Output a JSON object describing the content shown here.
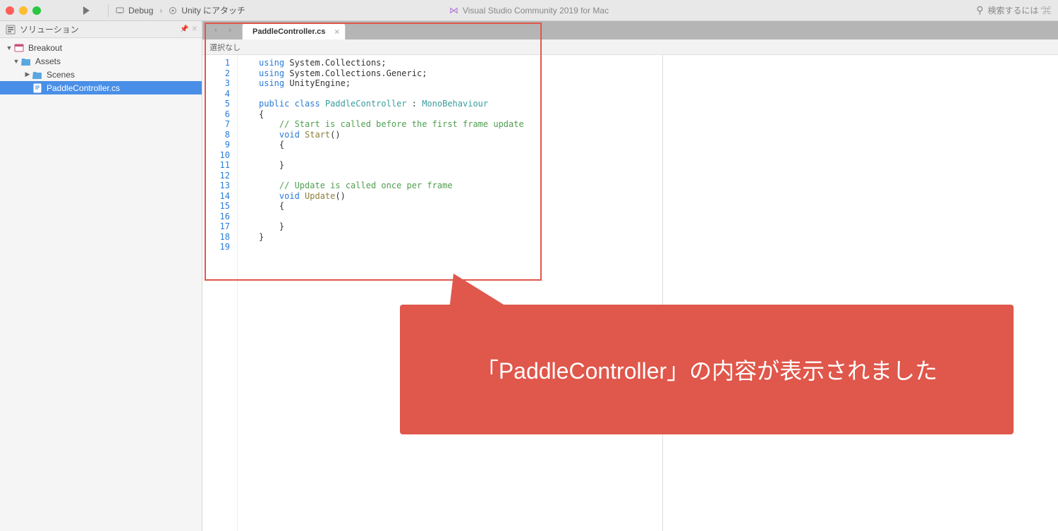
{
  "toolbar": {
    "config_name": "Debug",
    "attach_label": "Unity にアタッチ",
    "app_title": "Visual Studio Community 2019 for Mac",
    "search_hint": "検索するには '⌘"
  },
  "sidebar": {
    "panel_title": "ソリューション",
    "items": [
      {
        "label": "Breakout",
        "depth": 0,
        "type": "project",
        "expanded": true
      },
      {
        "label": "Assets",
        "depth": 1,
        "type": "folder",
        "expanded": true
      },
      {
        "label": "Scenes",
        "depth": 2,
        "type": "folder",
        "expanded": false
      },
      {
        "label": "PaddleController.cs",
        "depth": 2,
        "type": "file",
        "selected": true
      }
    ]
  },
  "tab": {
    "filename": "PaddleController.cs"
  },
  "breadcrumb": {
    "text": "選択なし"
  },
  "code": {
    "lines": [
      [
        {
          "t": "using ",
          "c": "kw"
        },
        {
          "t": "System.Collections;",
          "c": ""
        }
      ],
      [
        {
          "t": "using ",
          "c": "kw"
        },
        {
          "t": "System.Collections.Generic;",
          "c": ""
        }
      ],
      [
        {
          "t": "using ",
          "c": "kw"
        },
        {
          "t": "UnityEngine;",
          "c": ""
        }
      ],
      [
        {
          "t": "",
          "c": ""
        }
      ],
      [
        {
          "t": "public class ",
          "c": "kw"
        },
        {
          "t": "PaddleController",
          "c": "ty"
        },
        {
          "t": " : ",
          "c": ""
        },
        {
          "t": "MonoBehaviour",
          "c": "ty"
        }
      ],
      [
        {
          "t": "{",
          "c": ""
        }
      ],
      [
        {
          "t": "    ",
          "c": ""
        },
        {
          "t": "// Start is called before the first frame update",
          "c": "cmt"
        }
      ],
      [
        {
          "t": "    ",
          "c": ""
        },
        {
          "t": "void ",
          "c": "kw"
        },
        {
          "t": "Start",
          "c": "mth"
        },
        {
          "t": "()",
          "c": ""
        }
      ],
      [
        {
          "t": "    {",
          "c": ""
        }
      ],
      [
        {
          "t": "",
          "c": ""
        }
      ],
      [
        {
          "t": "    }",
          "c": ""
        }
      ],
      [
        {
          "t": "",
          "c": ""
        }
      ],
      [
        {
          "t": "    ",
          "c": ""
        },
        {
          "t": "// Update is called once per frame",
          "c": "cmt"
        }
      ],
      [
        {
          "t": "    ",
          "c": ""
        },
        {
          "t": "void ",
          "c": "kw"
        },
        {
          "t": "Update",
          "c": "mth"
        },
        {
          "t": "()",
          "c": ""
        }
      ],
      [
        {
          "t": "    {",
          "c": ""
        }
      ],
      [
        {
          "t": "",
          "c": ""
        }
      ],
      [
        {
          "t": "    }",
          "c": ""
        }
      ],
      [
        {
          "t": "}",
          "c": ""
        }
      ],
      [
        {
          "t": "",
          "c": ""
        }
      ]
    ]
  },
  "callout": {
    "text": "「PaddleController」の内容が表示されました"
  }
}
